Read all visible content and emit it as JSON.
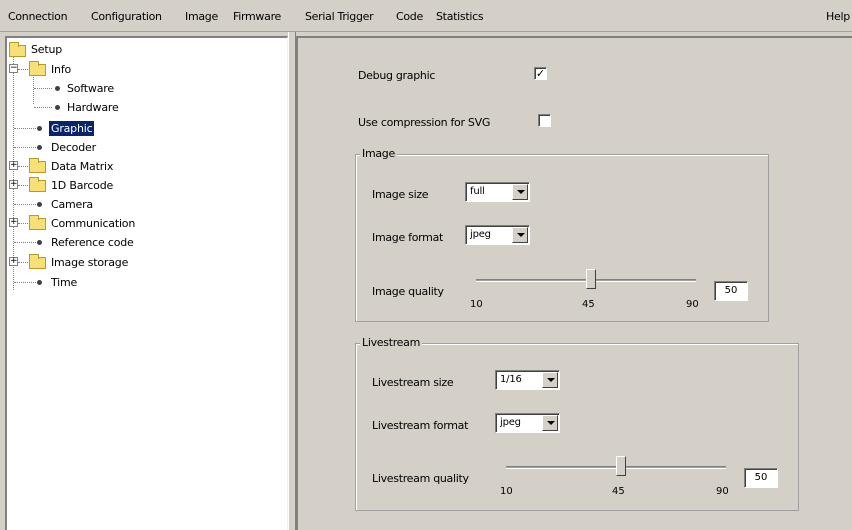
{
  "menubar": {
    "items": [
      "Connection",
      "Configuration",
      "Image",
      "Firmware",
      "Serial Trigger",
      "Code",
      "Statistics"
    ],
    "help": "Help"
  },
  "tree": {
    "root": "Setup",
    "nodes": [
      {
        "label": "Info",
        "type": "folder",
        "expander": "−"
      },
      {
        "label": "Software",
        "type": "leaf"
      },
      {
        "label": "Hardware",
        "type": "leaf"
      },
      {
        "label": "Graphic",
        "type": "leaf",
        "selected": true
      },
      {
        "label": "Decoder",
        "type": "leaf"
      },
      {
        "label": "Data Matrix",
        "type": "folder",
        "expander": "+"
      },
      {
        "label": "1D Barcode",
        "type": "folder",
        "expander": "+"
      },
      {
        "label": "Camera",
        "type": "leaf"
      },
      {
        "label": "Communication",
        "type": "folder",
        "expander": "+"
      },
      {
        "label": "Reference code",
        "type": "leaf"
      },
      {
        "label": "Image storage",
        "type": "folder",
        "expander": "+"
      },
      {
        "label": "Time",
        "type": "leaf"
      }
    ]
  },
  "settings": {
    "debug_graphic_label": "Debug graphic",
    "debug_graphic_checked": true,
    "debug_graphic_mark": "✓",
    "compression_label": "Use compression for SVG",
    "compression_checked": false,
    "compression_mark": ""
  },
  "image_group": {
    "title": "Image",
    "size_label": "Image size",
    "size_value": "full",
    "format_label": "Image format",
    "format_value": "jpeg",
    "quality_label": "Image quality",
    "quality_min": "10",
    "quality_mid": "45",
    "quality_max": "90",
    "quality_value": "50"
  },
  "livestream_group": {
    "title": "Livestream",
    "size_label": "Livestream size",
    "size_value": "1/16",
    "format_label": "Livestream format",
    "format_value": "jpeg",
    "quality_label": "Livestream quality",
    "quality_min": "10",
    "quality_mid": "45",
    "quality_max": "90",
    "quality_value": "50"
  }
}
